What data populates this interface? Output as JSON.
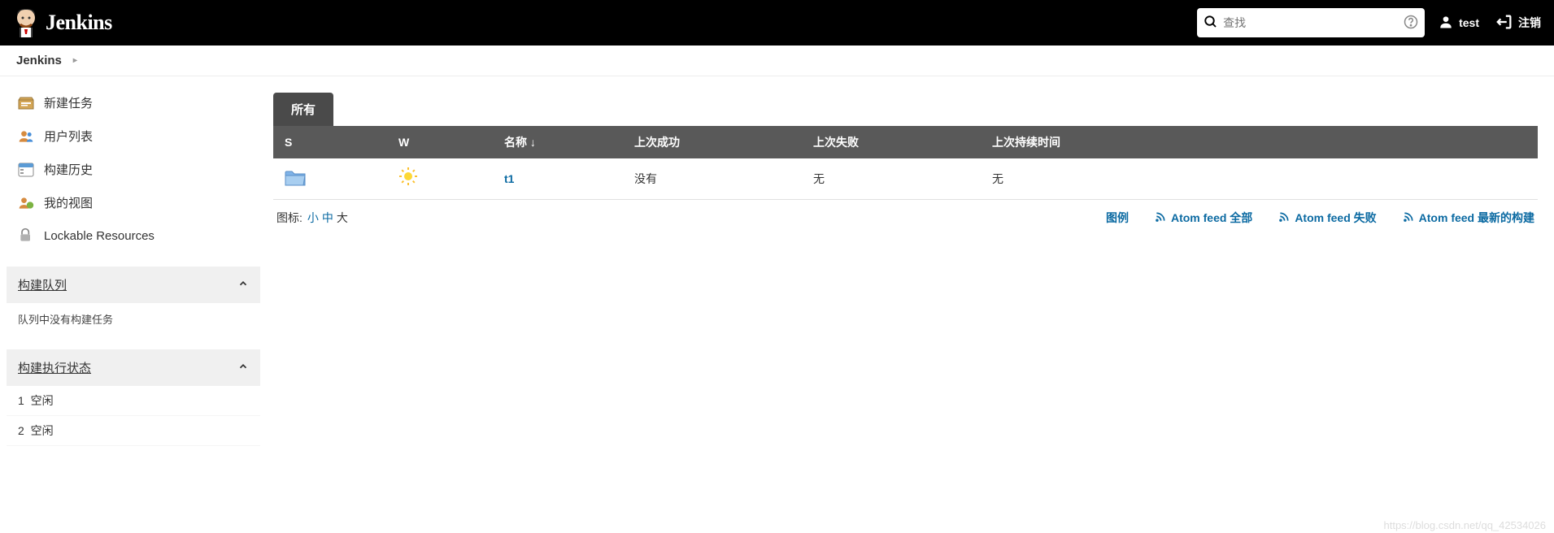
{
  "header": {
    "brand": "Jenkins",
    "search_placeholder": "查找",
    "username": "test",
    "logout": "注销"
  },
  "breadcrumb": {
    "items": [
      "Jenkins"
    ]
  },
  "sidebar": {
    "tasks": [
      {
        "label": "新建任务"
      },
      {
        "label": "用户列表"
      },
      {
        "label": "构建历史"
      },
      {
        "label": "我的视图"
      },
      {
        "label": "Lockable Resources"
      }
    ],
    "queue": {
      "title": "构建队列",
      "empty": "队列中没有构建任务"
    },
    "executors": {
      "title": "构建执行状态",
      "rows": [
        {
          "num": "1",
          "state": "空闲"
        },
        {
          "num": "2",
          "state": "空闲"
        }
      ]
    }
  },
  "main": {
    "tabs": [
      {
        "label": "所有"
      }
    ],
    "columns": {
      "s": "S",
      "w": "W",
      "name": "名称 ↓",
      "lastSuccess": "上次成功",
      "lastFailure": "上次失败",
      "lastDuration": "上次持续时间"
    },
    "rows": [
      {
        "status": "folder",
        "weather": "sunny",
        "name": "t1",
        "lastSuccess": "没有",
        "lastFailure": "无",
        "lastDuration": "无"
      }
    ],
    "iconSize": {
      "label": "图标:",
      "small": "小",
      "medium": "中",
      "large": "大"
    },
    "footerLinks": {
      "legend": "图例",
      "atomAll": "Atom feed 全部",
      "atomFail": "Atom feed 失败",
      "atomLatest": "Atom feed 最新的构建"
    }
  },
  "watermark": "https://blog.csdn.net/qq_42534026"
}
